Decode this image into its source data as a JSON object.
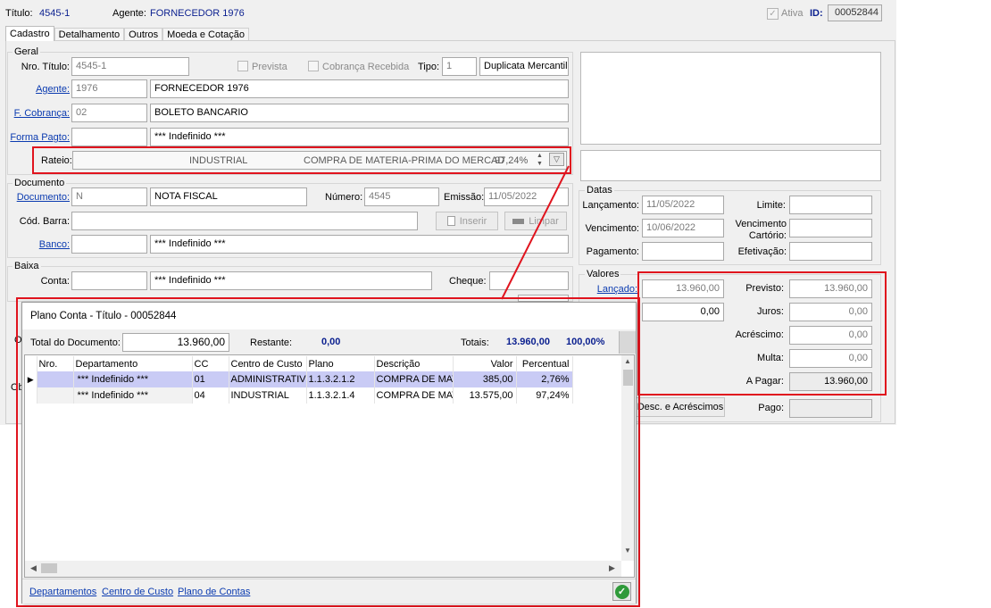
{
  "header": {
    "titulo_label": "Título:",
    "titulo_value": "4545-1",
    "agente_label": "Agente:",
    "agente_value": "FORNECEDOR 1976",
    "ativa_label": "Ativa",
    "id_label": "ID:",
    "id_value": "00052844"
  },
  "tabs": [
    {
      "label": "Cadastro"
    },
    {
      "label": "Detalhamento"
    },
    {
      "label": "Outros"
    },
    {
      "label": "Moeda e Cotação"
    }
  ],
  "geral": {
    "title": "Geral",
    "nro_titulo_label": "Nro. Título:",
    "nro_titulo_value": "4545-1",
    "prevista_label": "Prevista",
    "cobranca_recebida_label": "Cobrança Recebida",
    "tipo_label": "Tipo:",
    "tipo_code": "1",
    "tipo_desc": "Duplicata Mercantil",
    "agente_label": "Agente:",
    "agente_code": "1976",
    "agente_name": "FORNECEDOR 1976",
    "fcobranca_label": "F. Cobrança:",
    "fcobranca_code": "02",
    "fcobranca_name": "BOLETO BANCARIO",
    "forma_pagto_label": "Forma Pagto:",
    "forma_pagto_code": "",
    "forma_pagto_name": "*** Indefinido ***",
    "rateio_label": "Rateio:",
    "rateio_dept": "INDUSTRIAL",
    "rateio_desc": "COMPRA DE MATERIA-PRIMA DO MERCAD",
    "rateio_pct": "97,24%"
  },
  "documento": {
    "title": "Documento",
    "documento_label": "Documento:",
    "documento_code": "N",
    "documento_name": "NOTA FISCAL",
    "numero_label": "Número:",
    "numero_value": "4545",
    "emissao_label": "Emissão:",
    "emissao_value": "11/05/2022",
    "cod_barra_label": "Cód. Barra:",
    "inserir_label": "Inserir",
    "limpar_label": "Limpar",
    "banco_label": "Banco:",
    "banco_name": "*** Indefinido ***"
  },
  "baixa": {
    "title": "Baixa",
    "conta_label": "Conta:",
    "conta_name": "*** Indefinido ***",
    "cheque_label": "Cheque:",
    "partial_o": "O",
    "partial_ob": "Ob"
  },
  "datas": {
    "title": "Datas",
    "lancamento_label": "Lançamento:",
    "lancamento_value": "11/05/2022",
    "limite_label": "Limite:",
    "vencimento_label": "Vencimento:",
    "vencimento_value": "10/06/2022",
    "vencimento_cartorio_label_1": "Vencimento",
    "vencimento_cartorio_label_2": "Cartório:",
    "pagamento_label": "Pagamento:",
    "efetivacao_label": "Efetivação:"
  },
  "valores": {
    "title": "Valores",
    "lancado_label": "Lançado:",
    "lancado_value": "13.960,00",
    "second_value": "0,00",
    "previsto_label": "Previsto:",
    "previsto_value": "13.960,00",
    "juros_label": "Juros:",
    "juros_value": "0,00",
    "acrescimo_label": "Acréscimo:",
    "acrescimo_value": "0,00",
    "multa_label": "Multa:",
    "multa_value": "0,00",
    "a_pagar_label": "A Pagar:",
    "a_pagar_value": "13.960,00",
    "desc_acrescimos_label": "Desc. e Acréscimos",
    "pago_label": "Pago:"
  },
  "popup": {
    "title": "Plano Conta  - Título - 00052844",
    "total_label": "Total do Documento:",
    "total_value": "13.960,00",
    "restante_label": "Restante:",
    "restante_value": "0,00",
    "totais_label": "Totais:",
    "totais_value": "13.960,00",
    "totais_pct": "100,00%",
    "columns": [
      "Nro.",
      "Departamento",
      "CC",
      "Centro de Custo",
      "Plano",
      "Descrição",
      "Valor",
      "Percentual"
    ],
    "rows": [
      {
        "nro": "",
        "departamento": "*** Indefinido ***",
        "cc": "01",
        "centro": "ADMINISTRATIVO",
        "plano": "1.1.3.2.1.2",
        "descricao": "COMPRA DE MATE",
        "valor": "385,00",
        "percentual": "2,76%"
      },
      {
        "nro": "",
        "departamento": "*** Indefinido ***",
        "cc": "04",
        "centro": "INDUSTRIAL",
        "plano": "1.1.3.2.1.4",
        "descricao": "COMPRA DE MATE",
        "valor": "13.575,00",
        "percentual": "97,24%"
      }
    ],
    "links": {
      "departamentos": "Departamentos",
      "centro_custo": "Centro de Custo",
      "plano_contas": "Plano de Contas"
    }
  },
  "colors": {
    "highlight": "#e0141e",
    "link": "#0b3bb0",
    "selected_row": "#c9cbf5",
    "totals_blue": "#0a1f8f"
  }
}
